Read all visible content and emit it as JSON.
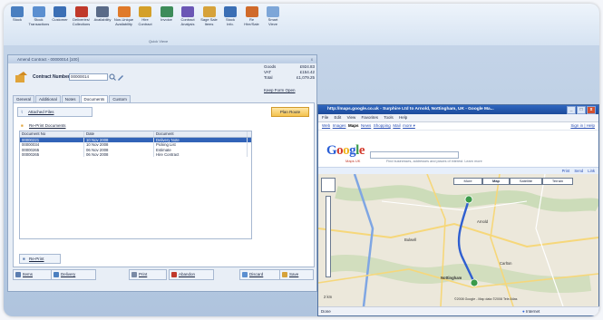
{
  "ribbon": {
    "buttons": [
      {
        "label": "Stock",
        "color": "#4a7fc0"
      },
      {
        "label": "Stock\nTransactions",
        "color": "#5b8fd0"
      },
      {
        "label": "Customer",
        "color": "#3b6fb5"
      },
      {
        "label": "Deliveries/\nCollections",
        "color": "#c0392b"
      },
      {
        "label": "Availability",
        "color": "#5a6b88"
      },
      {
        "label": "Non-Unique\nAvailability",
        "color": "#e07a2a"
      },
      {
        "label": "Hire\nContract",
        "color": "#d4a02a"
      },
      {
        "label": "Invoice",
        "color": "#3d8c5a"
      },
      {
        "label": "Contract\nAnalysis",
        "color": "#6b57b5"
      },
      {
        "label": "Sage Sale\nItems",
        "color": "#d6a23a"
      },
      {
        "label": "Stock\nInfo.",
        "color": "#3b6fb5"
      },
      {
        "label": "Re\nHire/Sale",
        "color": "#d06a2a"
      },
      {
        "label": "Smart\nVieve",
        "color": "#7da6d8"
      }
    ],
    "quick_view": "Quick Vieve"
  },
  "contract_window": {
    "title": "Amend Contract - 00000014 [100]",
    "close": "x",
    "contract_label": "Contract Number",
    "contract_value": "00000014",
    "totals": [
      {
        "label": "Goods",
        "value": "£924.83"
      },
      {
        "label": "VAT",
        "value": "£154.42"
      },
      {
        "label": "Total",
        "value": "£1,079.25"
      }
    ],
    "keep_form_open": "Keep Form Open",
    "tabs": [
      "General",
      "Additional",
      "Notes",
      "Documents",
      "Custom"
    ],
    "active_tab": "Documents",
    "attached_files": "Attached Files",
    "plan_route": "Plan Route",
    "reprint_documents": "Re-Print Documents",
    "grid": {
      "headers": [
        "Document No",
        "Date",
        "Document"
      ],
      "rows": [
        [
          "00000221",
          "10 Nov 2008",
          "Delivery Note"
        ],
        [
          "00000034",
          "10 Nov 2008",
          "Picking List"
        ],
        [
          "00000265",
          "06 Nov 2008",
          "Estimate"
        ],
        [
          "00000265",
          "06 Nov 2008",
          "Hire Contract"
        ]
      ],
      "selected_row": 0
    },
    "reprint_button": "Re-Print",
    "bottom_buttons": [
      "Items",
      "Delivery",
      "Print",
      "Abandon",
      "Discard",
      "Save"
    ]
  },
  "browser": {
    "title": "http://maps.google.co.uk - Surphire Ltd to Arnold, Nottingham, UK - Google Ma...",
    "controls": [
      "_",
      "□",
      "x"
    ],
    "menu": [
      "File",
      "Edit",
      "View",
      "Favorites",
      "Tools",
      "Help"
    ],
    "google_links": [
      "Web",
      "Images",
      "Maps",
      "News",
      "Shopping",
      "Mail",
      "more ▾"
    ],
    "active_link": "Maps",
    "sign_in": "Sign in | Help",
    "logo": "Google",
    "logo_sub": "Maps UK",
    "search_hint": "Find businesses, addresses and places of interest. Learn more",
    "print_links": "Print  Send  Link",
    "map_buttons": [
      "More",
      "Map",
      "Satellite",
      "Terrain"
    ],
    "active_map_button": "Map",
    "map_labels": [
      "Nottingham",
      "Carlton",
      "Bulwell",
      "Arnold"
    ],
    "map_scale": "2 km",
    "copyright": "©2008 Google - Map data ©2008 Tele Atlas",
    "status_left": "Done",
    "status_zone": "Internet",
    "colors": {
      "title_bar": "#1c4a9a",
      "route": "#2f5fd0",
      "motorway": "#7fa6e3",
      "green": "#b7d4a1"
    }
  }
}
